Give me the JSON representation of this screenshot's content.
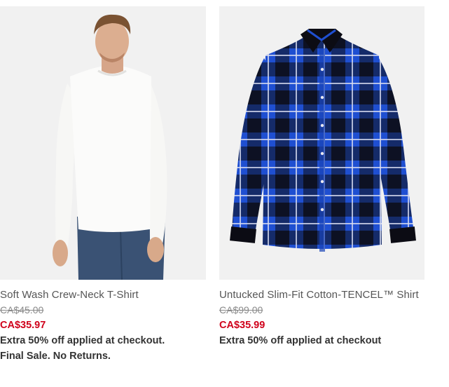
{
  "products": [
    {
      "name": "Soft Wash Crew-Neck T-Shirt",
      "original_price": "CA$45.00",
      "sale_price": "CA$35.97",
      "promo_lines": [
        "Extra 50% off applied at checkout.",
        "Final Sale. No Returns."
      ]
    },
    {
      "name": "Untucked Slim-Fit Cotton-TENCEL™ Shirt",
      "original_price": "CA$99.00",
      "sale_price": "CA$35.99",
      "promo_lines": [
        "Extra 50% off applied at checkout"
      ]
    }
  ],
  "colors": {
    "sale_price": "#d0021b",
    "original_price": "#8a8a8a",
    "name_text": "#555555",
    "promo_text": "#333333",
    "image_bg": "#f1f1f1",
    "plaid_blue": "#1f4fd1",
    "plaid_black": "#0c0c14"
  }
}
